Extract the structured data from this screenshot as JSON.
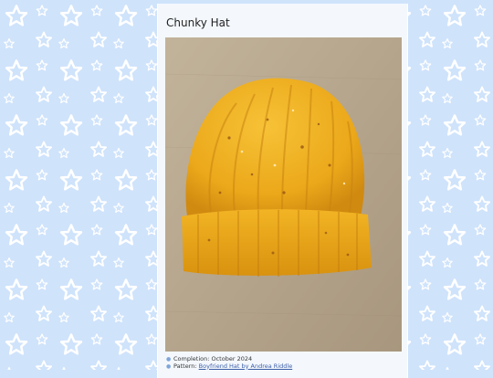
{
  "page": {
    "background_color": "#cfe3fb",
    "star_color": "#ffffff",
    "panel_color": "#f4f8fd"
  },
  "post": {
    "title": "Chunky Hat",
    "photo": {
      "subject": "mustard-yellow-chunky-knit-hat",
      "hat_color": "#f0b21e",
      "background_color": "#b6a68e"
    },
    "details": [
      {
        "label": "Completion: October 2024"
      },
      {
        "prefix": "Pattern: ",
        "link_text": "Boyfriend Hat by Andrea Riddle"
      }
    ],
    "bullet_icon": "●"
  }
}
